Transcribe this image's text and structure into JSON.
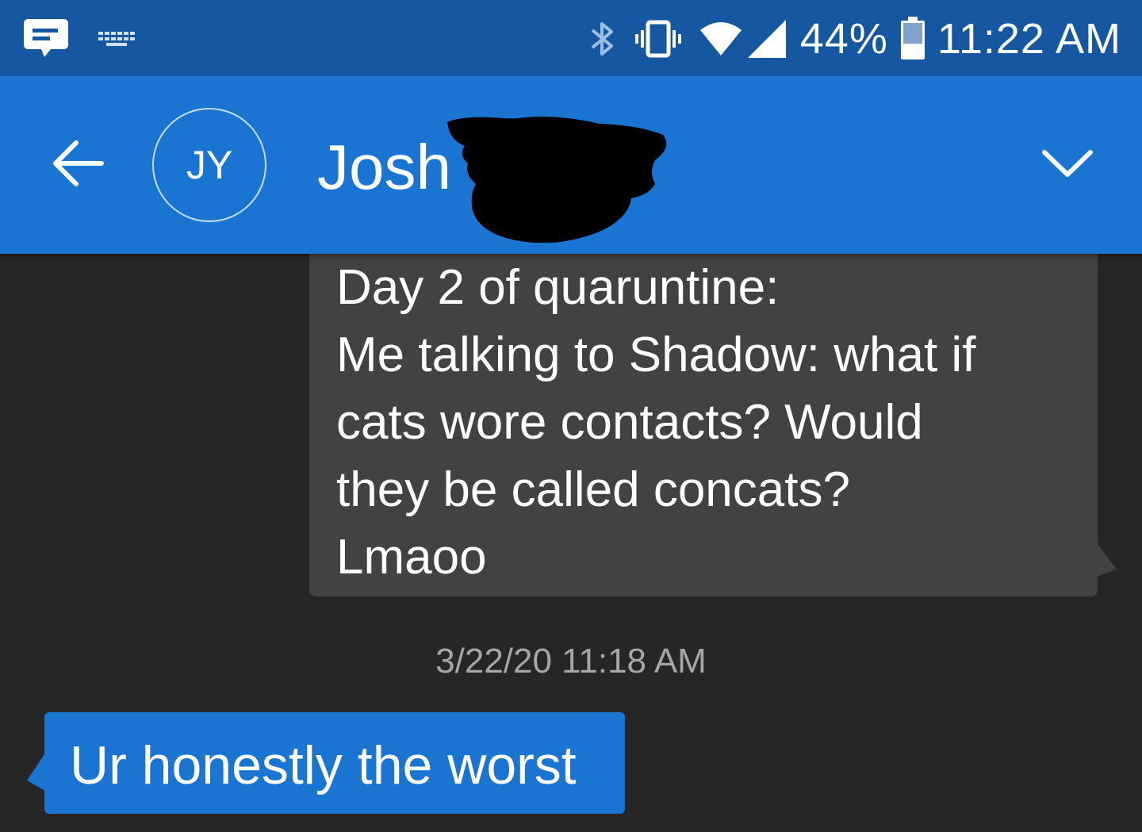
{
  "status_bar": {
    "battery_percent": "44%",
    "time": "11:22 AM",
    "icons": [
      "messages-notification-icon",
      "keyboard-icon",
      "bluetooth-icon",
      "vibrate-icon",
      "wifi-icon",
      "signal-icon",
      "battery-icon"
    ],
    "battery_level": 0.44
  },
  "header": {
    "avatar_initials": "JY",
    "contact_name": "Josh",
    "icons": [
      "back-arrow-icon",
      "chevron-down-icon"
    ],
    "colors": {
      "header": "#1a74d2",
      "status_bar": "#1557a1"
    }
  },
  "conversation": {
    "background": "#262626",
    "messages": [
      {
        "direction": "incoming",
        "text": "Day 2 of quaruntine:\nMe talking to Shadow: what if\ncats wore contacts? Would\nthey be called concats?\nLmaoo",
        "bubble_color": "#424242"
      },
      {
        "direction": "outgoing",
        "text": "Ur honestly the worst",
        "bubble_color": "#1a74d2"
      }
    ],
    "timestamp": "3/22/20 11:18 AM"
  }
}
